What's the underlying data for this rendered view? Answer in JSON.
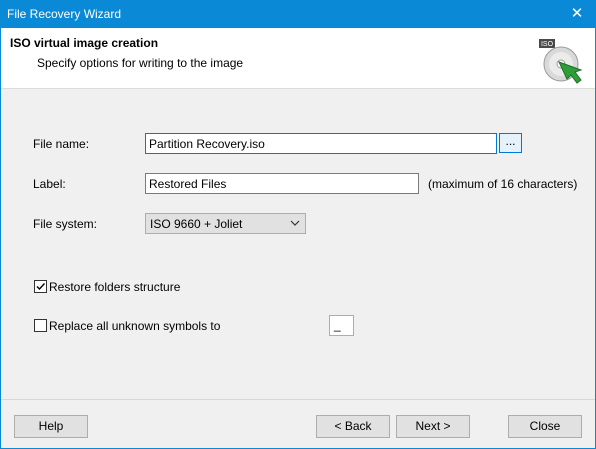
{
  "window": {
    "title": "File Recovery Wizard",
    "close_glyph": "✕"
  },
  "header": {
    "title": "ISO virtual image creation",
    "subtitle": "Specify options for writing to the image",
    "icon": "iso-disc-icon",
    "icon_badge": "ISO"
  },
  "form": {
    "file_name_label": "File name:",
    "file_name_value": "Partition Recovery.iso",
    "browse_label": "...",
    "label_label": "Label:",
    "label_value": "Restored Files",
    "label_hint": "(maximum of 16 characters)",
    "file_system_label": "File system:",
    "file_system_value": "ISO 9660 + Joliet",
    "restore_structure_label": "Restore folders structure",
    "restore_structure_checked": true,
    "replace_unknown_label": "Replace all unknown symbols to",
    "replace_unknown_checked": false,
    "replace_symbol_value": "_"
  },
  "footer": {
    "help_label": "Help",
    "back_label": "< Back",
    "next_label": "Next >",
    "close_label": "Close"
  },
  "colors": {
    "titlebar": "#0a8ad6",
    "focus_border": "#0078d7",
    "button_face": "#e1e1e1",
    "dialog_bg": "#f0f0f0",
    "arrow_green": "#2e9e3a"
  }
}
